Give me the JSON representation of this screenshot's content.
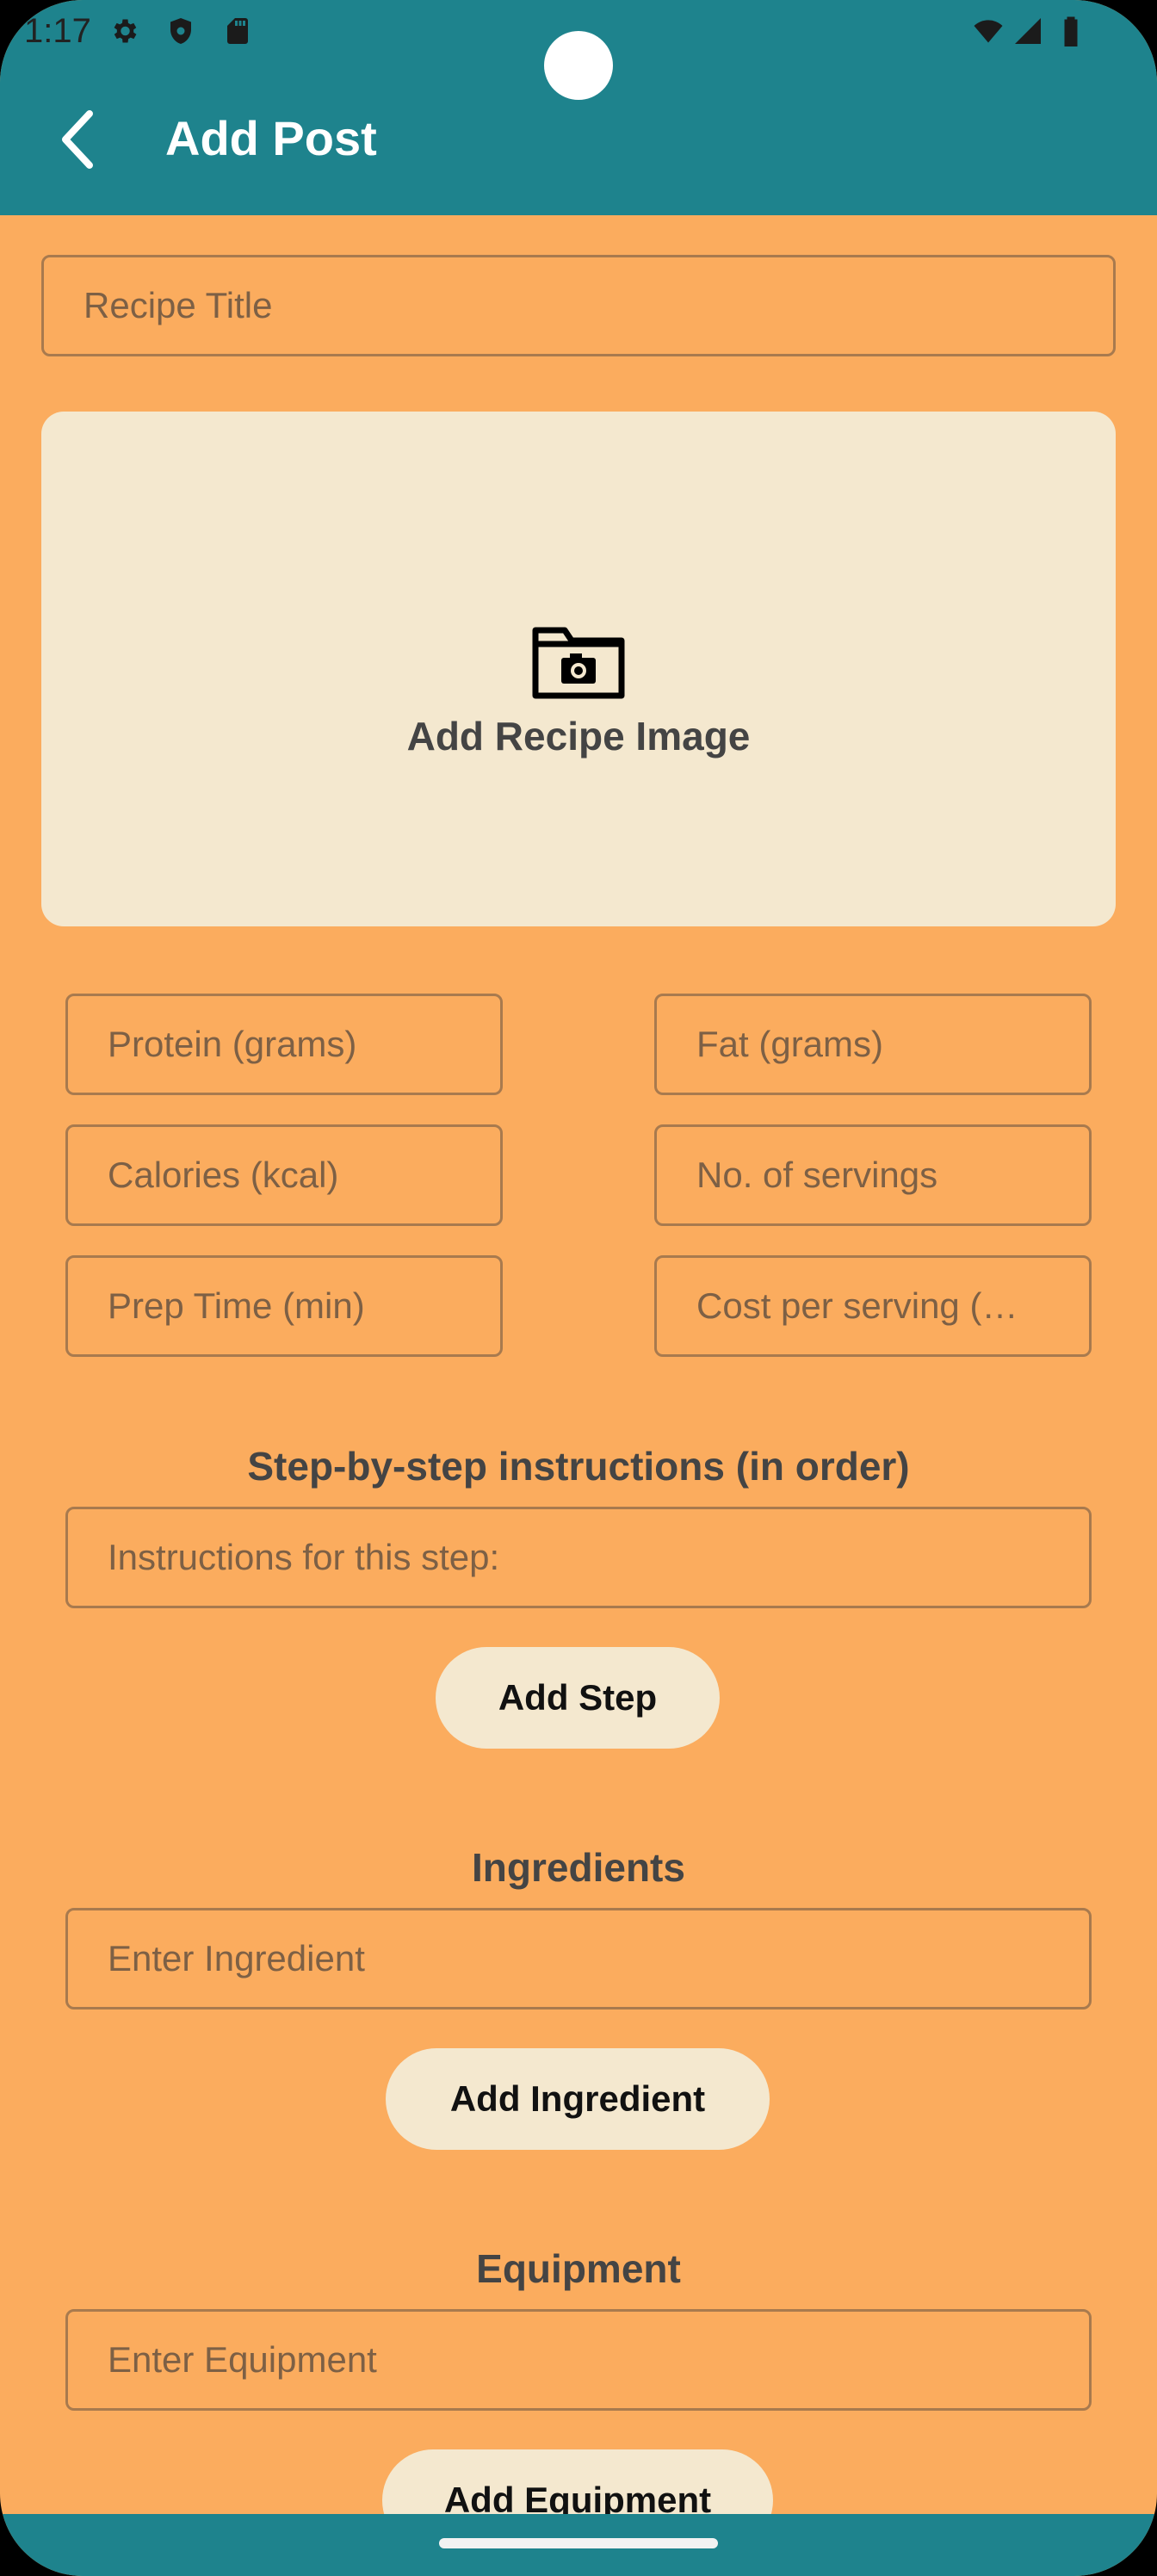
{
  "status_bar": {
    "time": "1:17",
    "icons": [
      "settings-icon",
      "shield-icon",
      "sd-card-icon",
      "wifi-icon",
      "signal-icon",
      "battery-icon"
    ]
  },
  "app_bar": {
    "title": "Add Post",
    "back_icon": "back-arrow-icon",
    "color": "#1E838D"
  },
  "form": {
    "recipe_title_placeholder": "Recipe Title",
    "image_label": "Add Recipe Image",
    "protein_placeholder": "Protein (grams)",
    "fat_placeholder": "Fat (grams)",
    "calories_placeholder": "Calories (kcal)",
    "servings_placeholder": "No. of servings",
    "prep_time_placeholder": "Prep Time (min)",
    "cost_placeholder": "Cost per serving (…",
    "steps_title": "Step-by-step instructions (in order)",
    "step_placeholder": "Instructions for this step:",
    "add_step_label": "Add Step",
    "ingredients_title": "Ingredients",
    "ingredient_placeholder": "Enter Ingredient",
    "add_ingredient_label": "Add Ingredient",
    "equipment_title": "Equipment",
    "equipment_placeholder": "Enter Equipment",
    "add_equipment_label": "Add Equipment"
  },
  "colors": {
    "background": "#FBAC5E",
    "accent": "#1E838D",
    "card": "#F4E8CF"
  }
}
